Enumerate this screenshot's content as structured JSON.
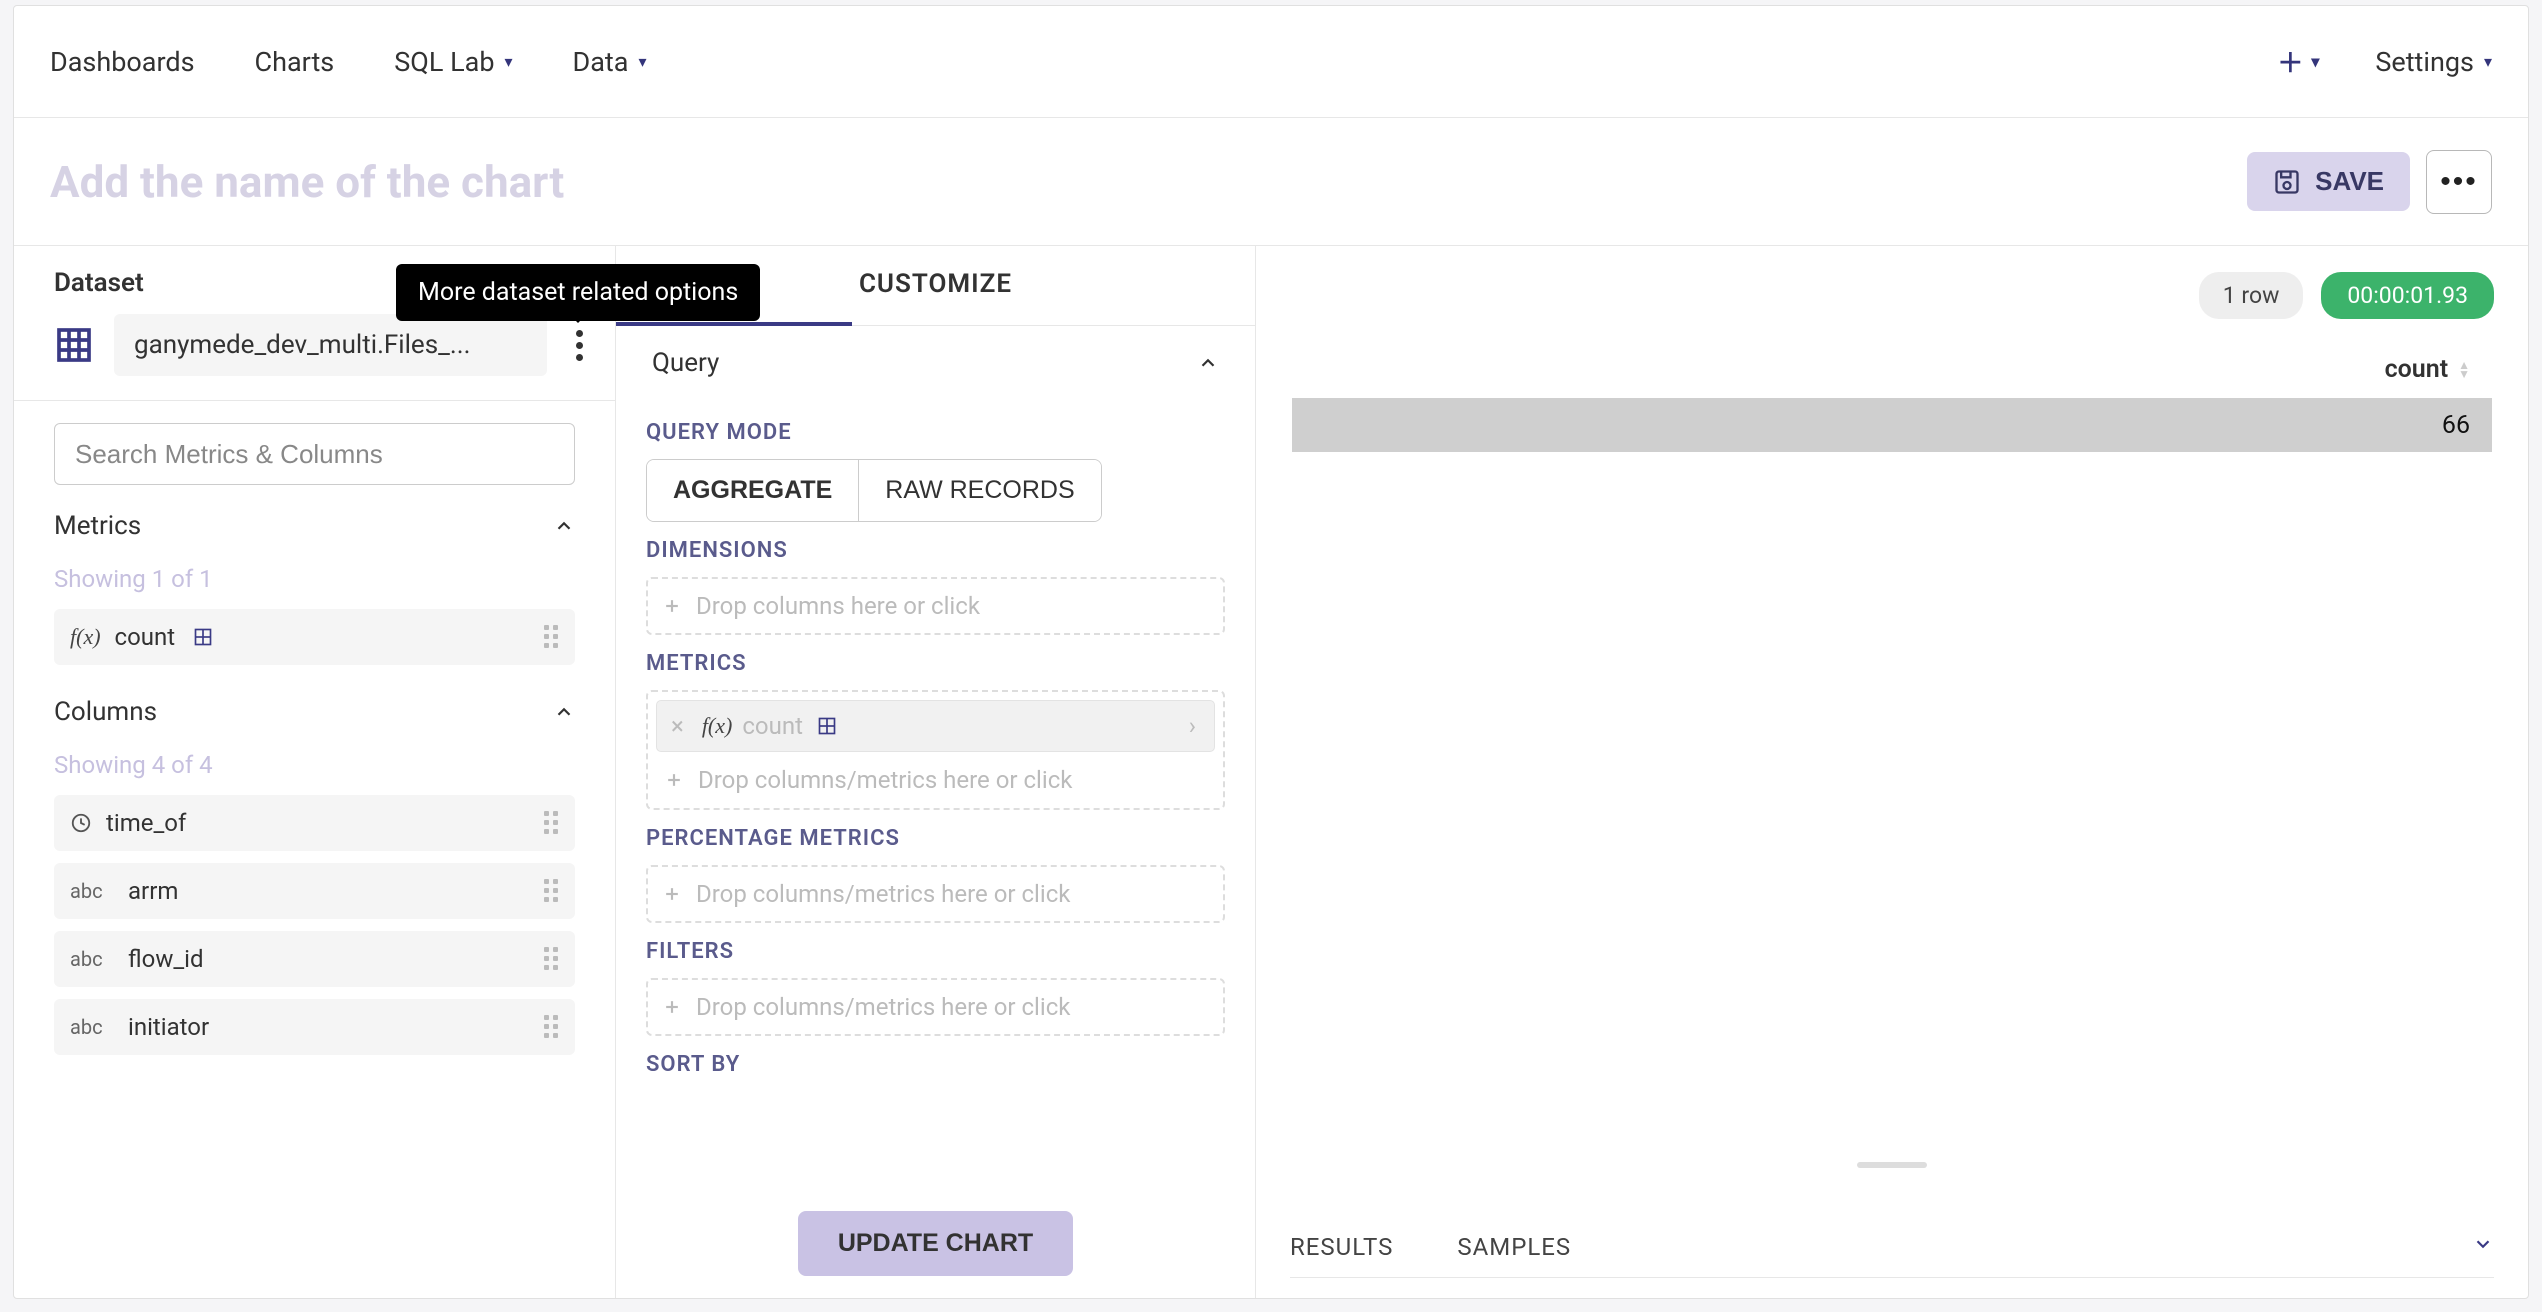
{
  "nav": {
    "dashboards": "Dashboards",
    "charts": "Charts",
    "sql_lab": "SQL Lab",
    "data": "Data",
    "settings": "Settings"
  },
  "header": {
    "title_placeholder": "Add the name of the chart",
    "save_label": "SAVE"
  },
  "dataset": {
    "section_label": "Dataset",
    "name": "ganymede_dev_multi.Files_...",
    "tooltip": "More dataset related options",
    "search_placeholder": "Search Metrics & Columns",
    "metrics_label": "Metrics",
    "metrics_count": "Showing 1 of 1",
    "metrics": [
      {
        "type": "fx",
        "label": "count",
        "has_subicon": true
      }
    ],
    "columns_label": "Columns",
    "columns_count": "Showing 4 of 4",
    "columns": [
      {
        "type": "clock",
        "label": "time_of"
      },
      {
        "type": "abc",
        "label": "arrm"
      },
      {
        "type": "abc",
        "label": "flow_id"
      },
      {
        "type": "abc",
        "label": "initiator"
      }
    ]
  },
  "query": {
    "tabs": {
      "customize": "CUSTOMIZE"
    },
    "section_label": "Query",
    "query_mode_label": "QUERY MODE",
    "aggregate_label": "AGGREGATE",
    "raw_records_label": "RAW RECORDS",
    "dimensions_label": "DIMENSIONS",
    "dimensions_placeholder": "Drop columns here or click",
    "metrics_label": "METRICS",
    "metrics_pill": "count",
    "metrics_placeholder": "Drop columns/metrics here or click",
    "pct_metrics_label": "PERCENTAGE METRICS",
    "pct_metrics_placeholder": "Drop columns/metrics here or click",
    "filters_label": "FILTERS",
    "filters_placeholder": "Drop columns/metrics here or click",
    "sort_by_label": "SORT BY",
    "update_label": "UPDATE CHART"
  },
  "results": {
    "row_count": "1 row",
    "elapsed": "00:00:01.93",
    "column_header": "count",
    "value": "66",
    "tabs": {
      "results": "RESULTS",
      "samples": "SAMPLES"
    }
  }
}
